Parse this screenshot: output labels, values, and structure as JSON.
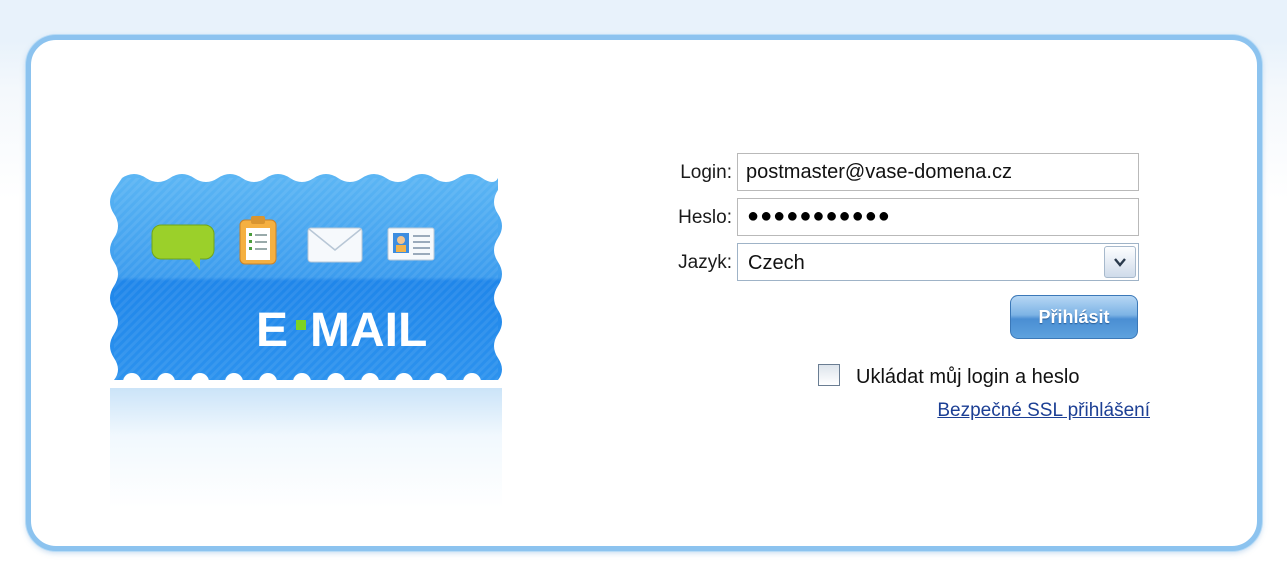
{
  "logo": {
    "text_prefix": "E",
    "text_suffix": "MAIL",
    "icons": [
      "chat-bubble-icon",
      "clipboard-icon",
      "envelope-icon",
      "contact-card-icon"
    ],
    "colors": {
      "stamp_blue": "#2e8fe8",
      "stamp_light": "#5cb3f2",
      "dot_green": "#7dd321"
    }
  },
  "form": {
    "login_label": "Login:",
    "login_value": "postmaster@vase-domena.cz",
    "password_label": "Heslo:",
    "password_mask": "●●●●●●●●●●●",
    "language_label": "Jazyk:",
    "language_value": "Czech",
    "submit_label": "Přihlásit",
    "remember_label": "Ukládat můj login a heslo",
    "remember_checked": false,
    "ssl_link": "Bezpečné SSL přihlášení"
  },
  "colors": {
    "panel_border": "#8cc3ef",
    "button_blue": "#4a8ed3",
    "link": "#1c3f94"
  }
}
